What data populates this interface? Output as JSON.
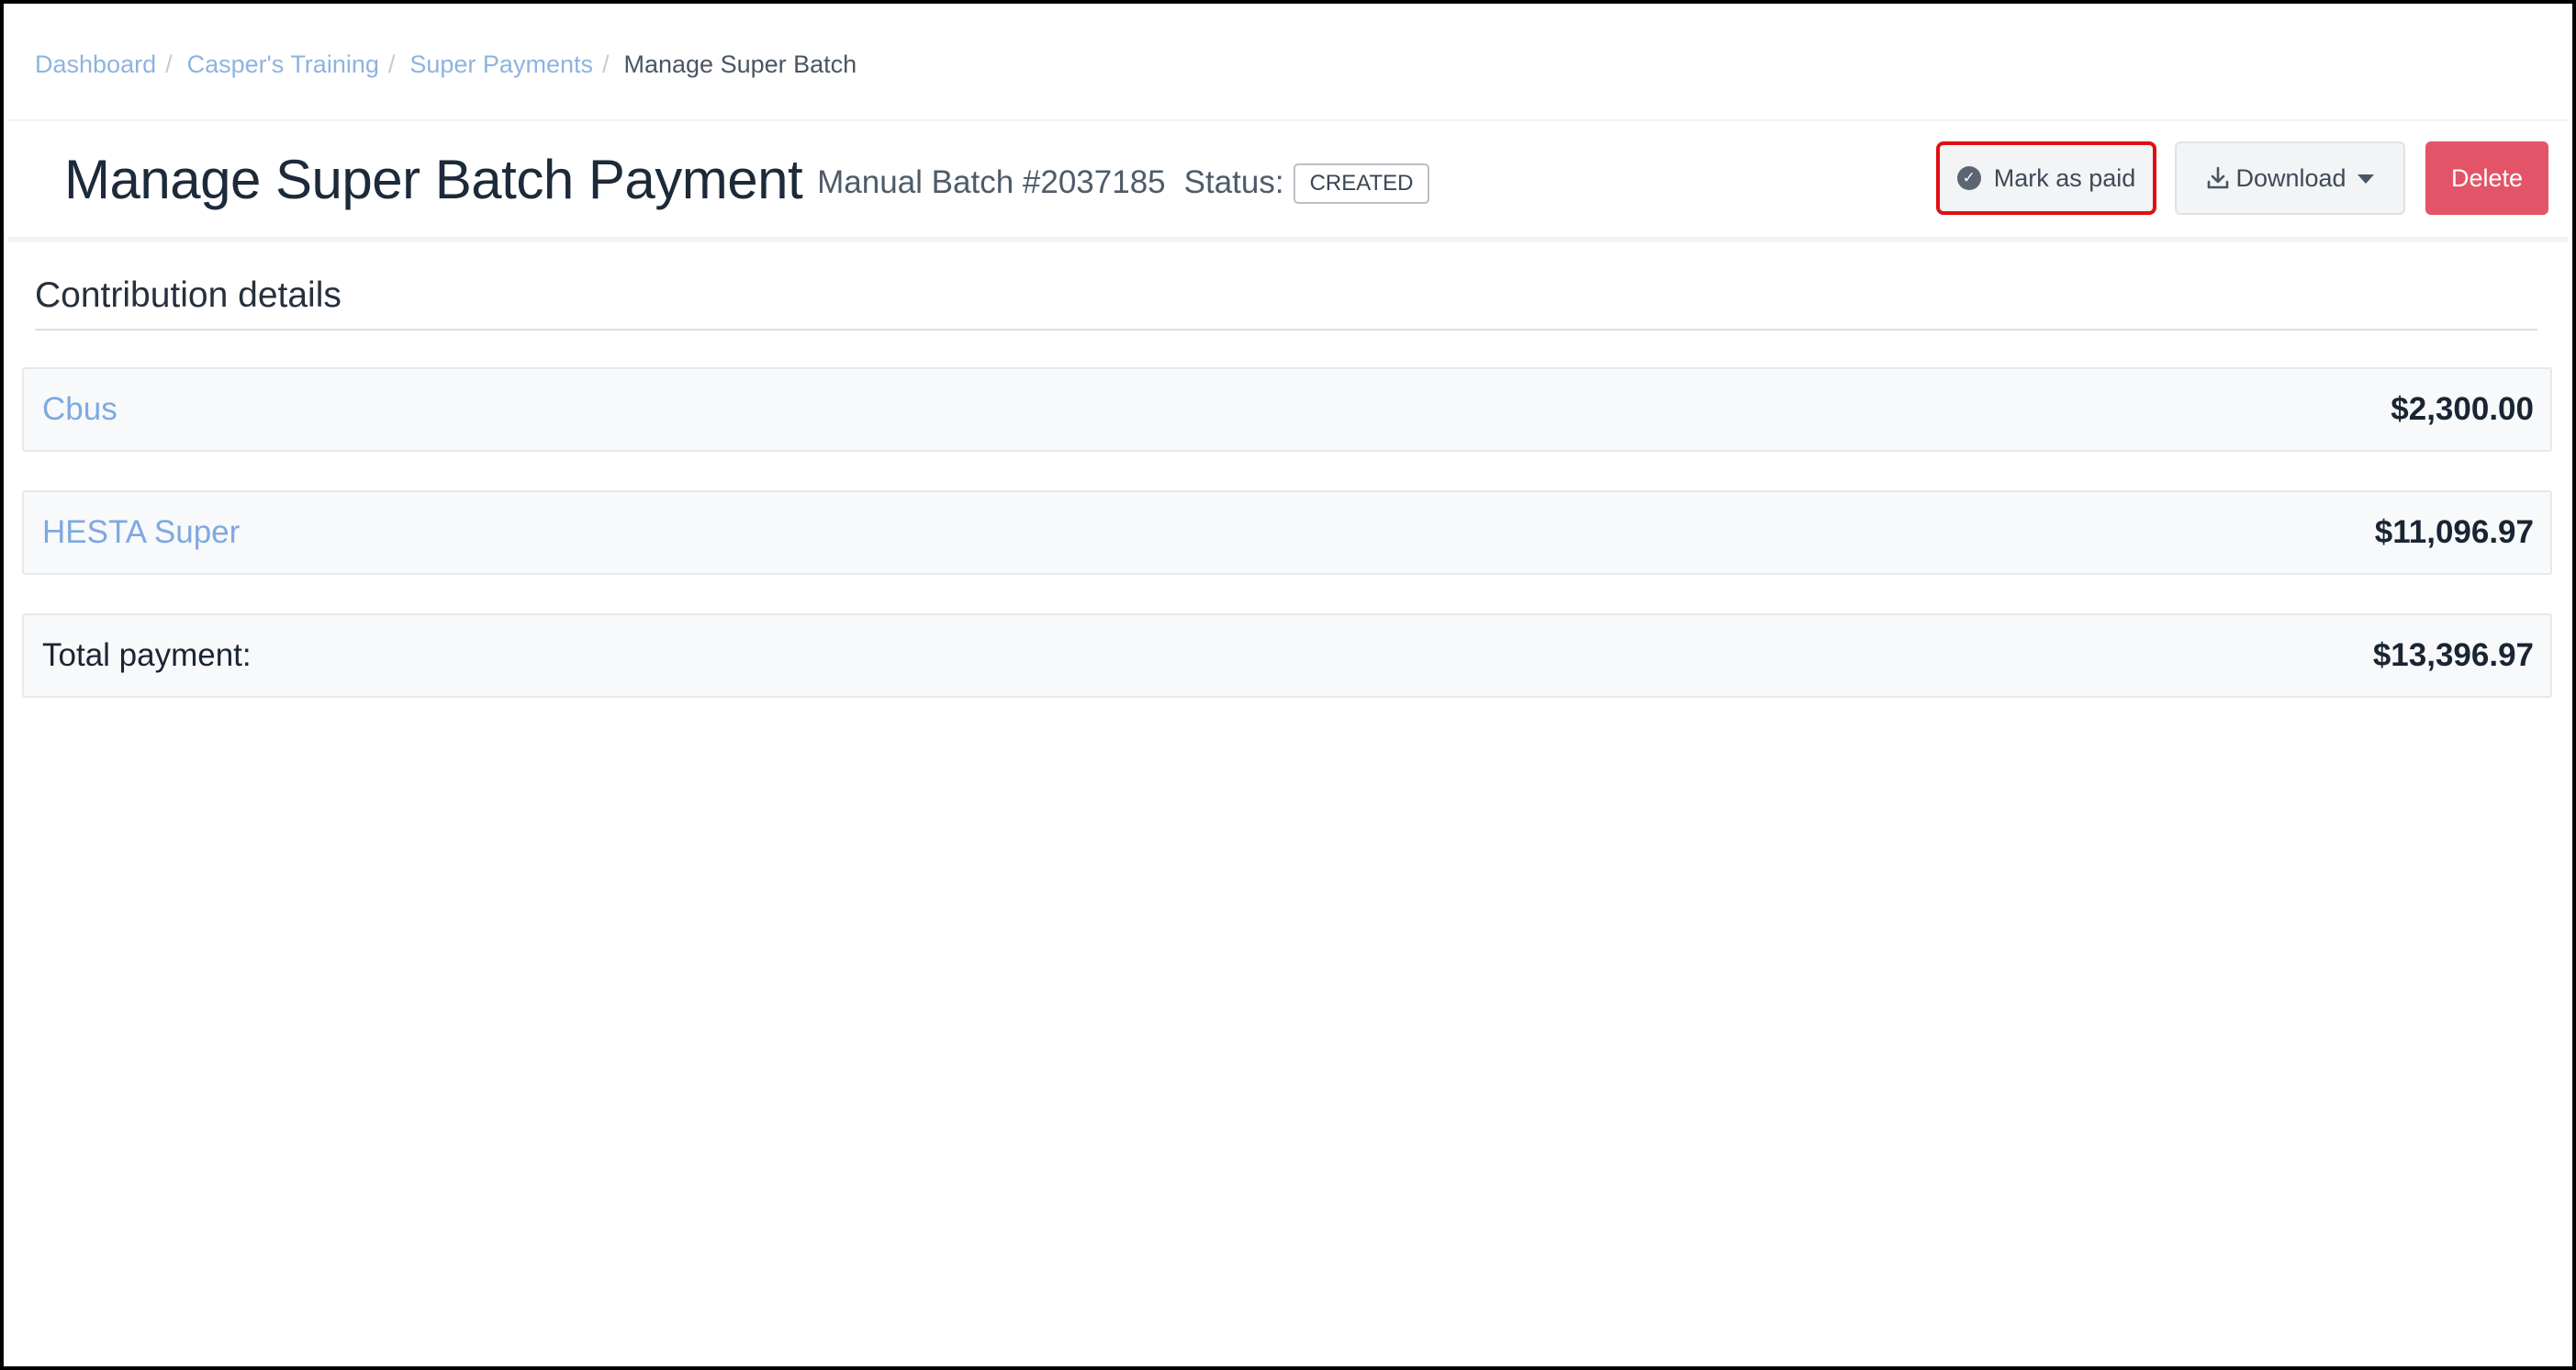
{
  "breadcrumb": {
    "items": [
      {
        "label": "Dashboard"
      },
      {
        "label": "Casper's Training"
      },
      {
        "label": "Super Payments"
      }
    ],
    "separator": "/",
    "current": "Manage Super Batch"
  },
  "header": {
    "title": "Manage Super Batch Payment",
    "batch": "Manual Batch #2037185",
    "status_label": "Status:",
    "status_value": "CREATED"
  },
  "actions": {
    "mark_paid_label": "Mark as paid",
    "download_label": "Download",
    "delete_label": "Delete"
  },
  "contributions": {
    "section_title": "Contribution details",
    "rows": [
      {
        "fund": "Cbus",
        "amount": "$2,300.00"
      },
      {
        "fund": "HESTA Super",
        "amount": "$11,096.97"
      }
    ],
    "total_label": "Total payment:",
    "total_amount": "$13,396.97"
  },
  "icons": {
    "mark_paid": "check-circle-icon",
    "download": "download-icon",
    "download_caret": "caret-down-icon"
  },
  "colors": {
    "link": "#7ea9e1",
    "delete_button": "#e35468",
    "highlight_border": "#e01010"
  }
}
